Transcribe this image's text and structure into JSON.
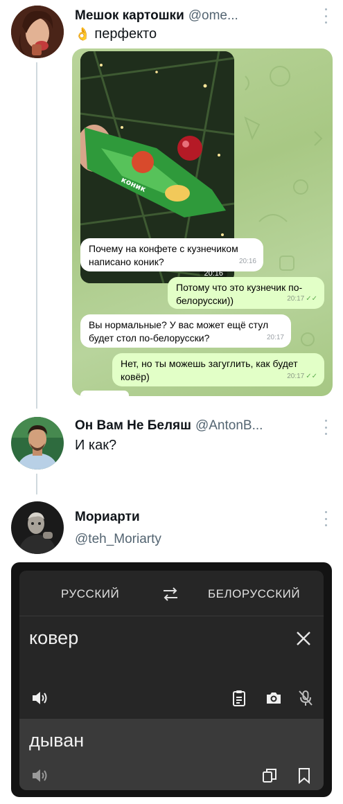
{
  "tweets": [
    {
      "name": "Мешок картошки",
      "handle": "@ome...",
      "text_emoji": "👌",
      "text": "перфекто",
      "telegram": {
        "photo_label": "коник",
        "photo_time": "20:16",
        "messages": [
          {
            "dir": "in",
            "text": "Почему на конфете с кузнечиком написано коник?",
            "time": "20:16"
          },
          {
            "dir": "out",
            "text": "Потому что это кузнечик по-белорусски))",
            "time": "20:17"
          },
          {
            "dir": "in",
            "text": "Вы нормальные? У вас может ещё стул будет стол по-белорусски?",
            "time": "20:17"
          },
          {
            "dir": "out",
            "text": "Нет, но ты можешь загуглить, как будет ковёр)",
            "time": "20:17"
          }
        ]
      }
    },
    {
      "name": "Он Вам Не Беляш",
      "handle": "@AntonB...",
      "text": "И как?"
    },
    {
      "name": "Мориарти",
      "handle": "@teh_Moriarty"
    }
  ],
  "translator": {
    "source_lang": "РУССКИЙ",
    "target_lang": "БЕЛОРУССКИЙ",
    "input_text": "ковер",
    "result_text": "дыван",
    "icons": [
      "swap-icon",
      "close-icon",
      "speaker-icon",
      "clipboard-icon",
      "camera-icon",
      "mic-off-icon",
      "copy-icon",
      "bookmark-icon"
    ]
  },
  "colors": {
    "handle": "#536471",
    "thread_line": "#cfd9de",
    "translator_bg": "#262626",
    "translator_result_bg": "#3a3a3a",
    "tg_outgoing": "#e2ffc7"
  }
}
